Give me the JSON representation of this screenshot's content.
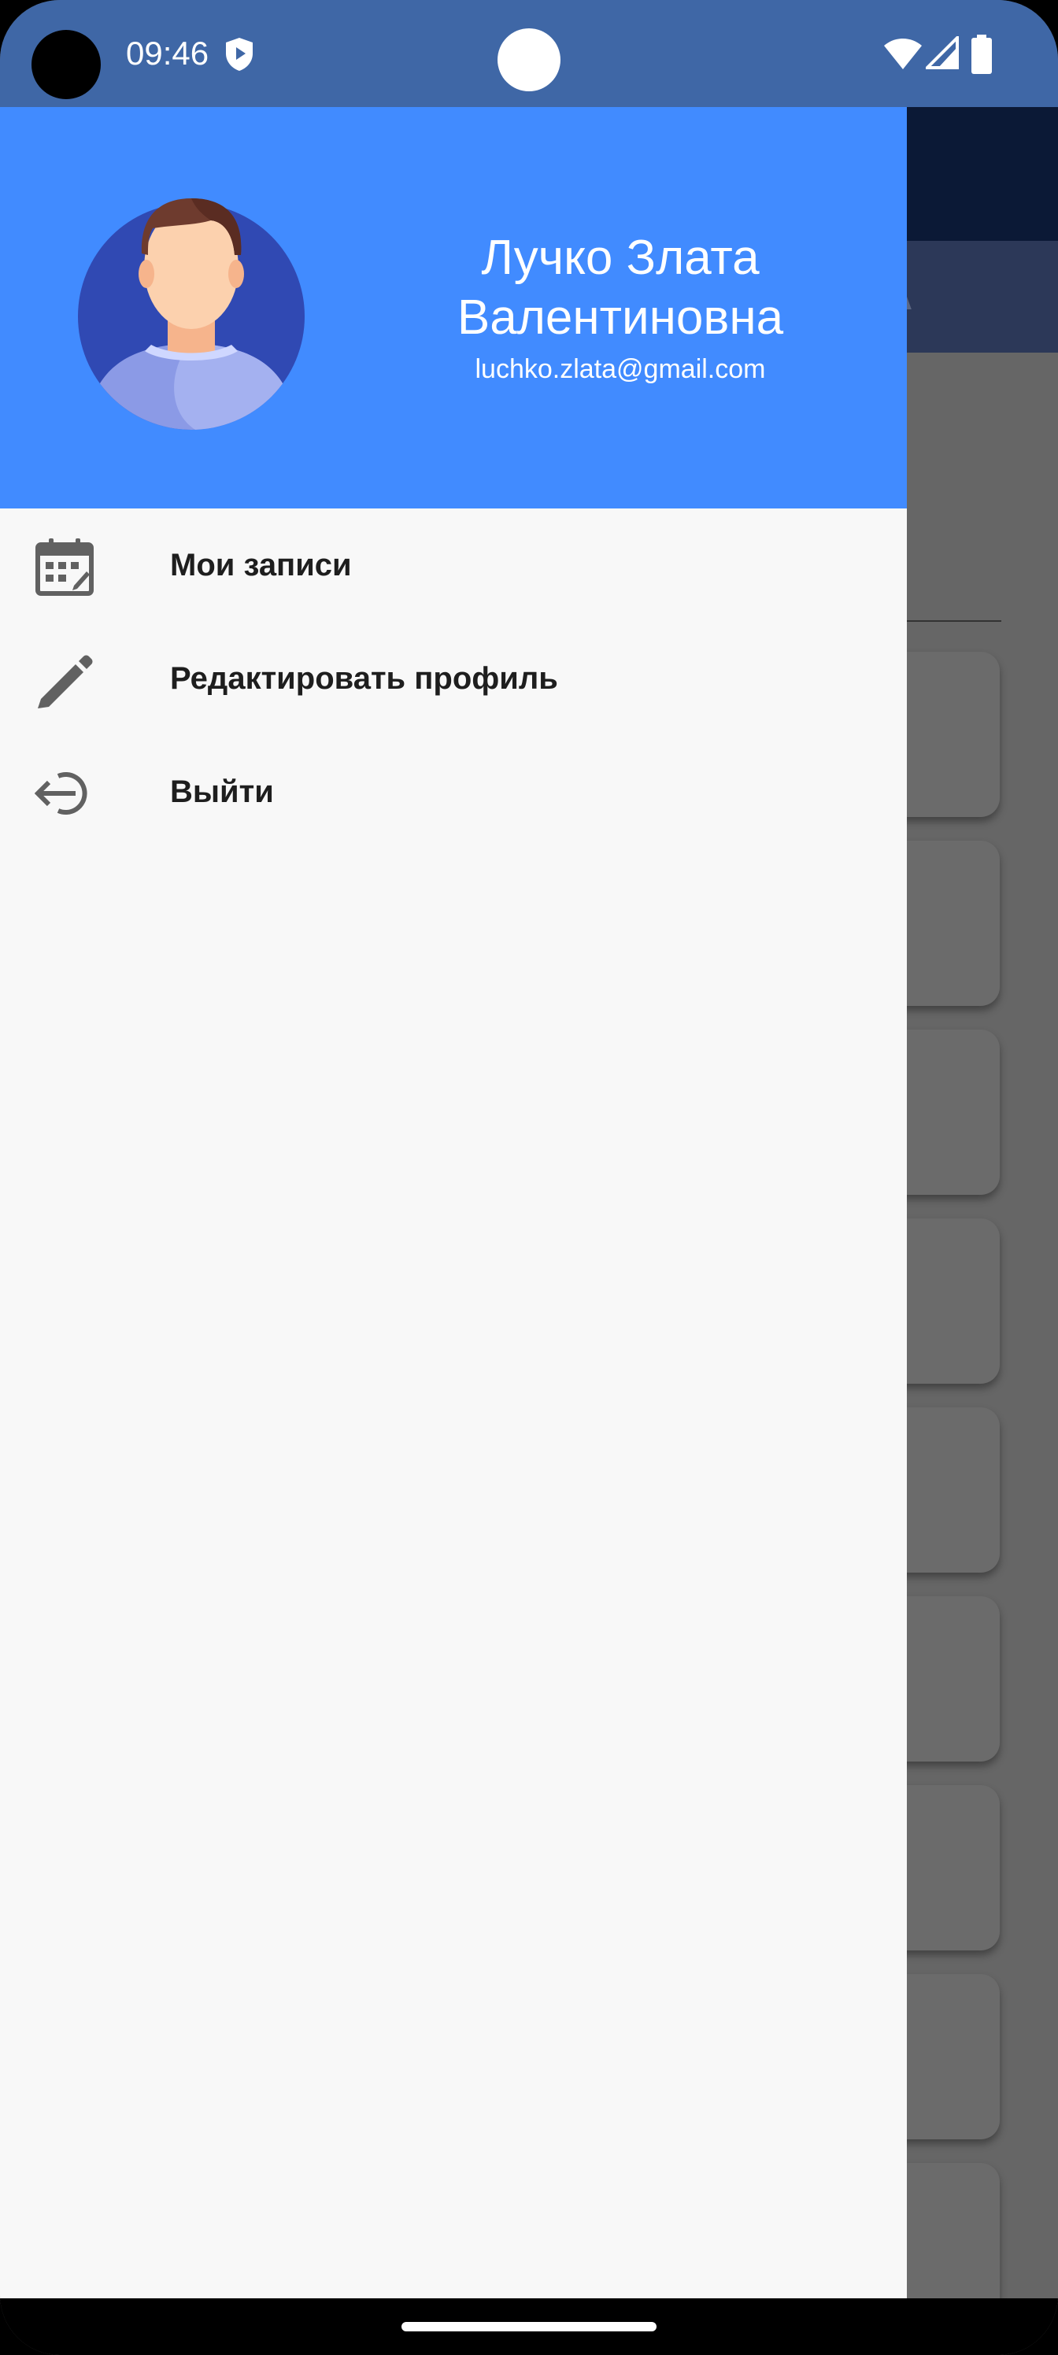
{
  "status_bar": {
    "time": "09:46",
    "icons": [
      "shield-play-icon",
      "wifi-icon",
      "signal-icon",
      "battery-icon"
    ],
    "color": "#3f67a6"
  },
  "background_app": {
    "tab_partial_text": "A",
    "toolbar_color": "#0b1936",
    "tabs_color": "#2c3858"
  },
  "drawer": {
    "header_color": "#418bff",
    "user": {
      "name": "Лучко Злата Валентиновна",
      "email": "luchko.zlata@gmail.com"
    },
    "menu": [
      {
        "label": "Мои записи",
        "icon": "calendar-icon"
      },
      {
        "label": "Редактировать профиль",
        "icon": "pencil-icon"
      },
      {
        "label": "Выйти",
        "icon": "logout-icon"
      }
    ]
  }
}
